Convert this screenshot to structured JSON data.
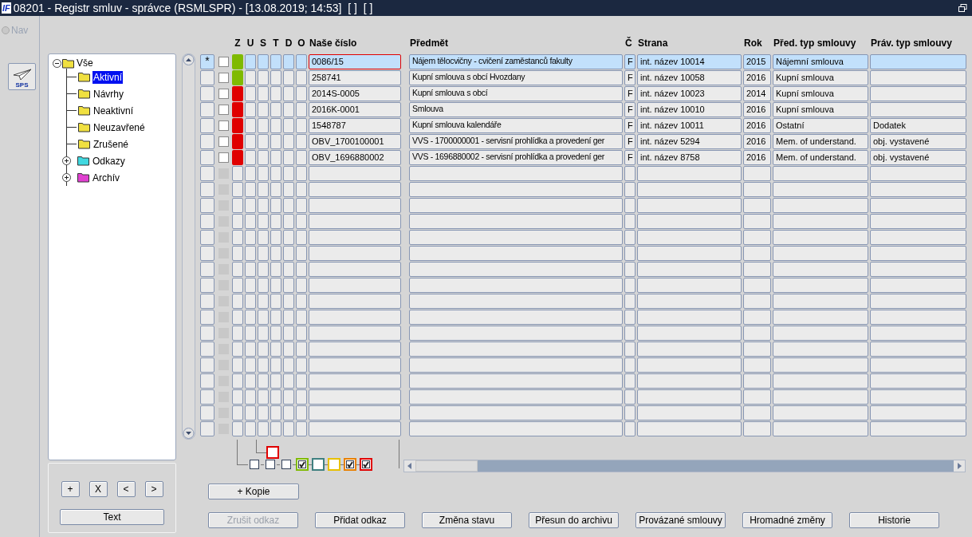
{
  "window": {
    "logo": "IF",
    "title": "08201 - Registr smluv - správce (RSMLSPR) - [13.08.2019; 14:53]  [ ]  [ ]"
  },
  "nav": {
    "label": "Nav",
    "disabled": true
  },
  "sps_button": {
    "label": "SPS"
  },
  "tree": {
    "label": "Vše",
    "expanded": true,
    "color": "#f0e040",
    "children": [
      {
        "label": "Aktivní",
        "selected": true,
        "color": "#f0e040"
      },
      {
        "label": "Návrhy",
        "selected": false,
        "color": "#f0e040"
      },
      {
        "label": "Neaktivní",
        "selected": false,
        "color": "#f0e040"
      },
      {
        "label": "Neuzavřené",
        "selected": false,
        "color": "#f0e040"
      },
      {
        "label": "Zrušené",
        "selected": false,
        "color": "#f0e040"
      },
      {
        "label": "Odkazy",
        "selected": false,
        "expanded": false,
        "color": "#40d8e0"
      },
      {
        "label": "Archív",
        "selected": false,
        "expanded": false,
        "color": "#e040d0"
      }
    ]
  },
  "tree_buttons": [
    "+",
    "X",
    "<",
    ">"
  ],
  "text_button": "Text",
  "columns": [
    "Z",
    "U",
    "S",
    "T",
    "D",
    "O",
    "Naše číslo",
    "Předmět",
    "Č",
    "Strana",
    "Rok",
    "Před. typ smlouvy",
    "Práv. typ smlouvy"
  ],
  "rows": [
    {
      "marker": "*",
      "selected": true,
      "checked": false,
      "color": "#7fba00",
      "focused": true,
      "cells": [
        "0086/15",
        "Nájem tělocvičny - cvičení zaměstanců fakulty",
        "F",
        "int. název 10014",
        "2015",
        "Nájemní smlouva",
        ""
      ]
    },
    {
      "selected": false,
      "checked": false,
      "color": "#7fba00",
      "focused": false,
      "cells": [
        "258741",
        "Kupní smlouva s obcí Hvozdany",
        "F",
        "int. název 10058",
        "2016",
        "Kupní smlouva",
        ""
      ]
    },
    {
      "selected": false,
      "checked": false,
      "color": "#e00000",
      "focused": false,
      "cells": [
        "2014S-0005",
        "Kupní smlouva s obcí",
        "F",
        "int. název 10023",
        "2014",
        "Kupní smlouva",
        ""
      ]
    },
    {
      "selected": false,
      "checked": false,
      "color": "#e00000",
      "focused": false,
      "cells": [
        "2016K-0001",
        "Smlouva",
        "F",
        "int. název 10010",
        "2016",
        "Kupní smlouva",
        ""
      ]
    },
    {
      "selected": false,
      "checked": false,
      "color": "#e00000",
      "focused": false,
      "cells": [
        "1548787",
        "Kupní smlouva kalendáře",
        "F",
        "int. název 10011",
        "2016",
        "Ostatní",
        "Dodatek"
      ]
    },
    {
      "selected": false,
      "checked": false,
      "color": "#e00000",
      "focused": false,
      "cells": [
        "OBV_1700100001",
        "VVS - 1700000001 - servisní prohlídka a provedení ger",
        "F",
        "int. název 5294",
        "2016",
        "Mem. of understand.",
        "obj. vystavené"
      ]
    },
    {
      "selected": false,
      "checked": false,
      "color": "#e00000",
      "focused": false,
      "cells": [
        "OBV_1696880002",
        "VVS - 1696880002 - servisní prohlídka a provedení ger",
        "F",
        "int. název 8758",
        "2016",
        "Mem. of understand.",
        "obj. vystavené"
      ]
    }
  ],
  "legend_top": {
    "color": "#e00000",
    "checked": false
  },
  "legend": [
    {
      "checked": false
    },
    {
      "checked": false
    },
    {
      "checked": false
    },
    {
      "color": "#7fba00",
      "checked": true
    },
    {
      "color": "#3f8080",
      "checked": false
    },
    {
      "color": "#e8c000",
      "checked": false
    },
    {
      "color": "#e88000",
      "checked": true
    },
    {
      "color": "#e00000",
      "checked": true
    }
  ],
  "copy_button": "+ Kopie",
  "buttons": [
    {
      "label": "Zrušit odkaz",
      "disabled": true
    },
    {
      "label": "Přidat odkaz",
      "disabled": false
    },
    {
      "label": "Změna stavu",
      "disabled": false
    },
    {
      "label": "Přesun do archivu",
      "disabled": false
    },
    {
      "label": "Provázané smlouvy",
      "disabled": false
    },
    {
      "label": "Hromadné změny",
      "disabled": false
    },
    {
      "label": "Historie",
      "disabled": false
    }
  ]
}
